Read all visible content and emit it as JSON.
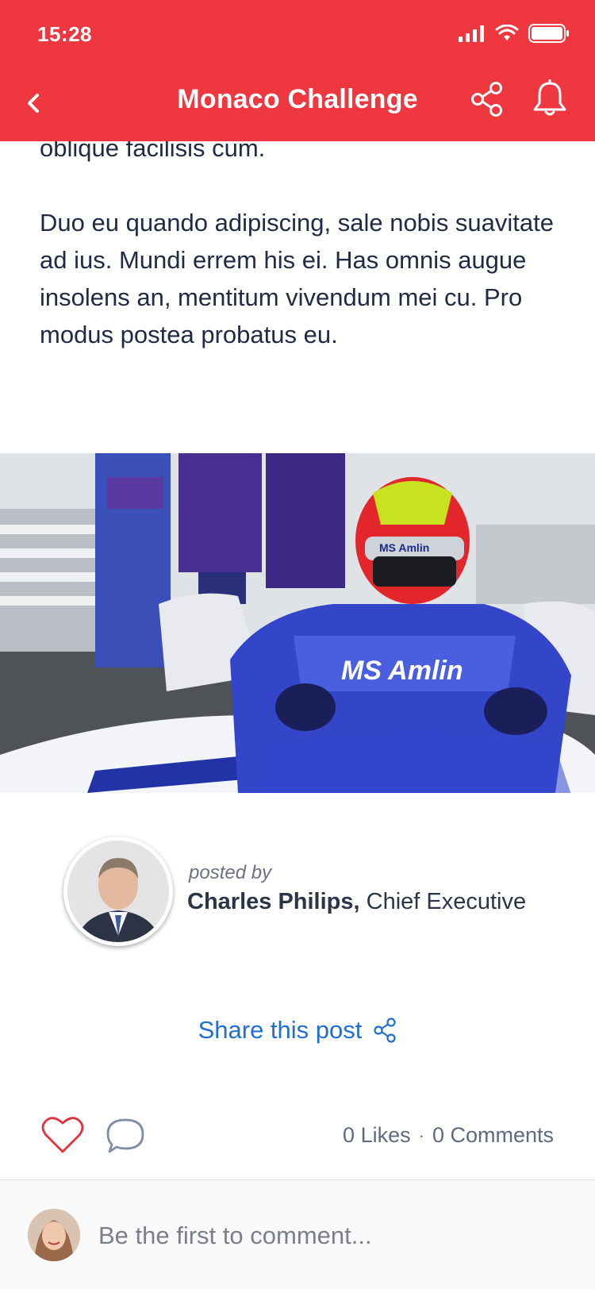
{
  "status_bar": {
    "time": "15:28"
  },
  "header": {
    "title": "Monaco Challenge",
    "background_color": "#ef3740"
  },
  "article": {
    "paragraphs": [
      "constituam ei vis, eos errore populo eu. At meis oblique facilisis cum.",
      "Duo eu quando adipiscing, sale nobis suavitate ad ius. Mundi errem his ei. Has omnis augue insolens an, mentitum vivendum mei cu. Pro modus postea probatus eu."
    ]
  },
  "author": {
    "posted_by": "posted by",
    "name": "Charles Philips,",
    "role": "Chief Executive"
  },
  "share_post": {
    "label": "Share this post",
    "color": "#1f6fd1"
  },
  "engagement": {
    "likes": "0 Likes",
    "separator": "·",
    "comments": "0 Comments"
  },
  "comment_box": {
    "placeholder": "Be the first to comment..."
  }
}
